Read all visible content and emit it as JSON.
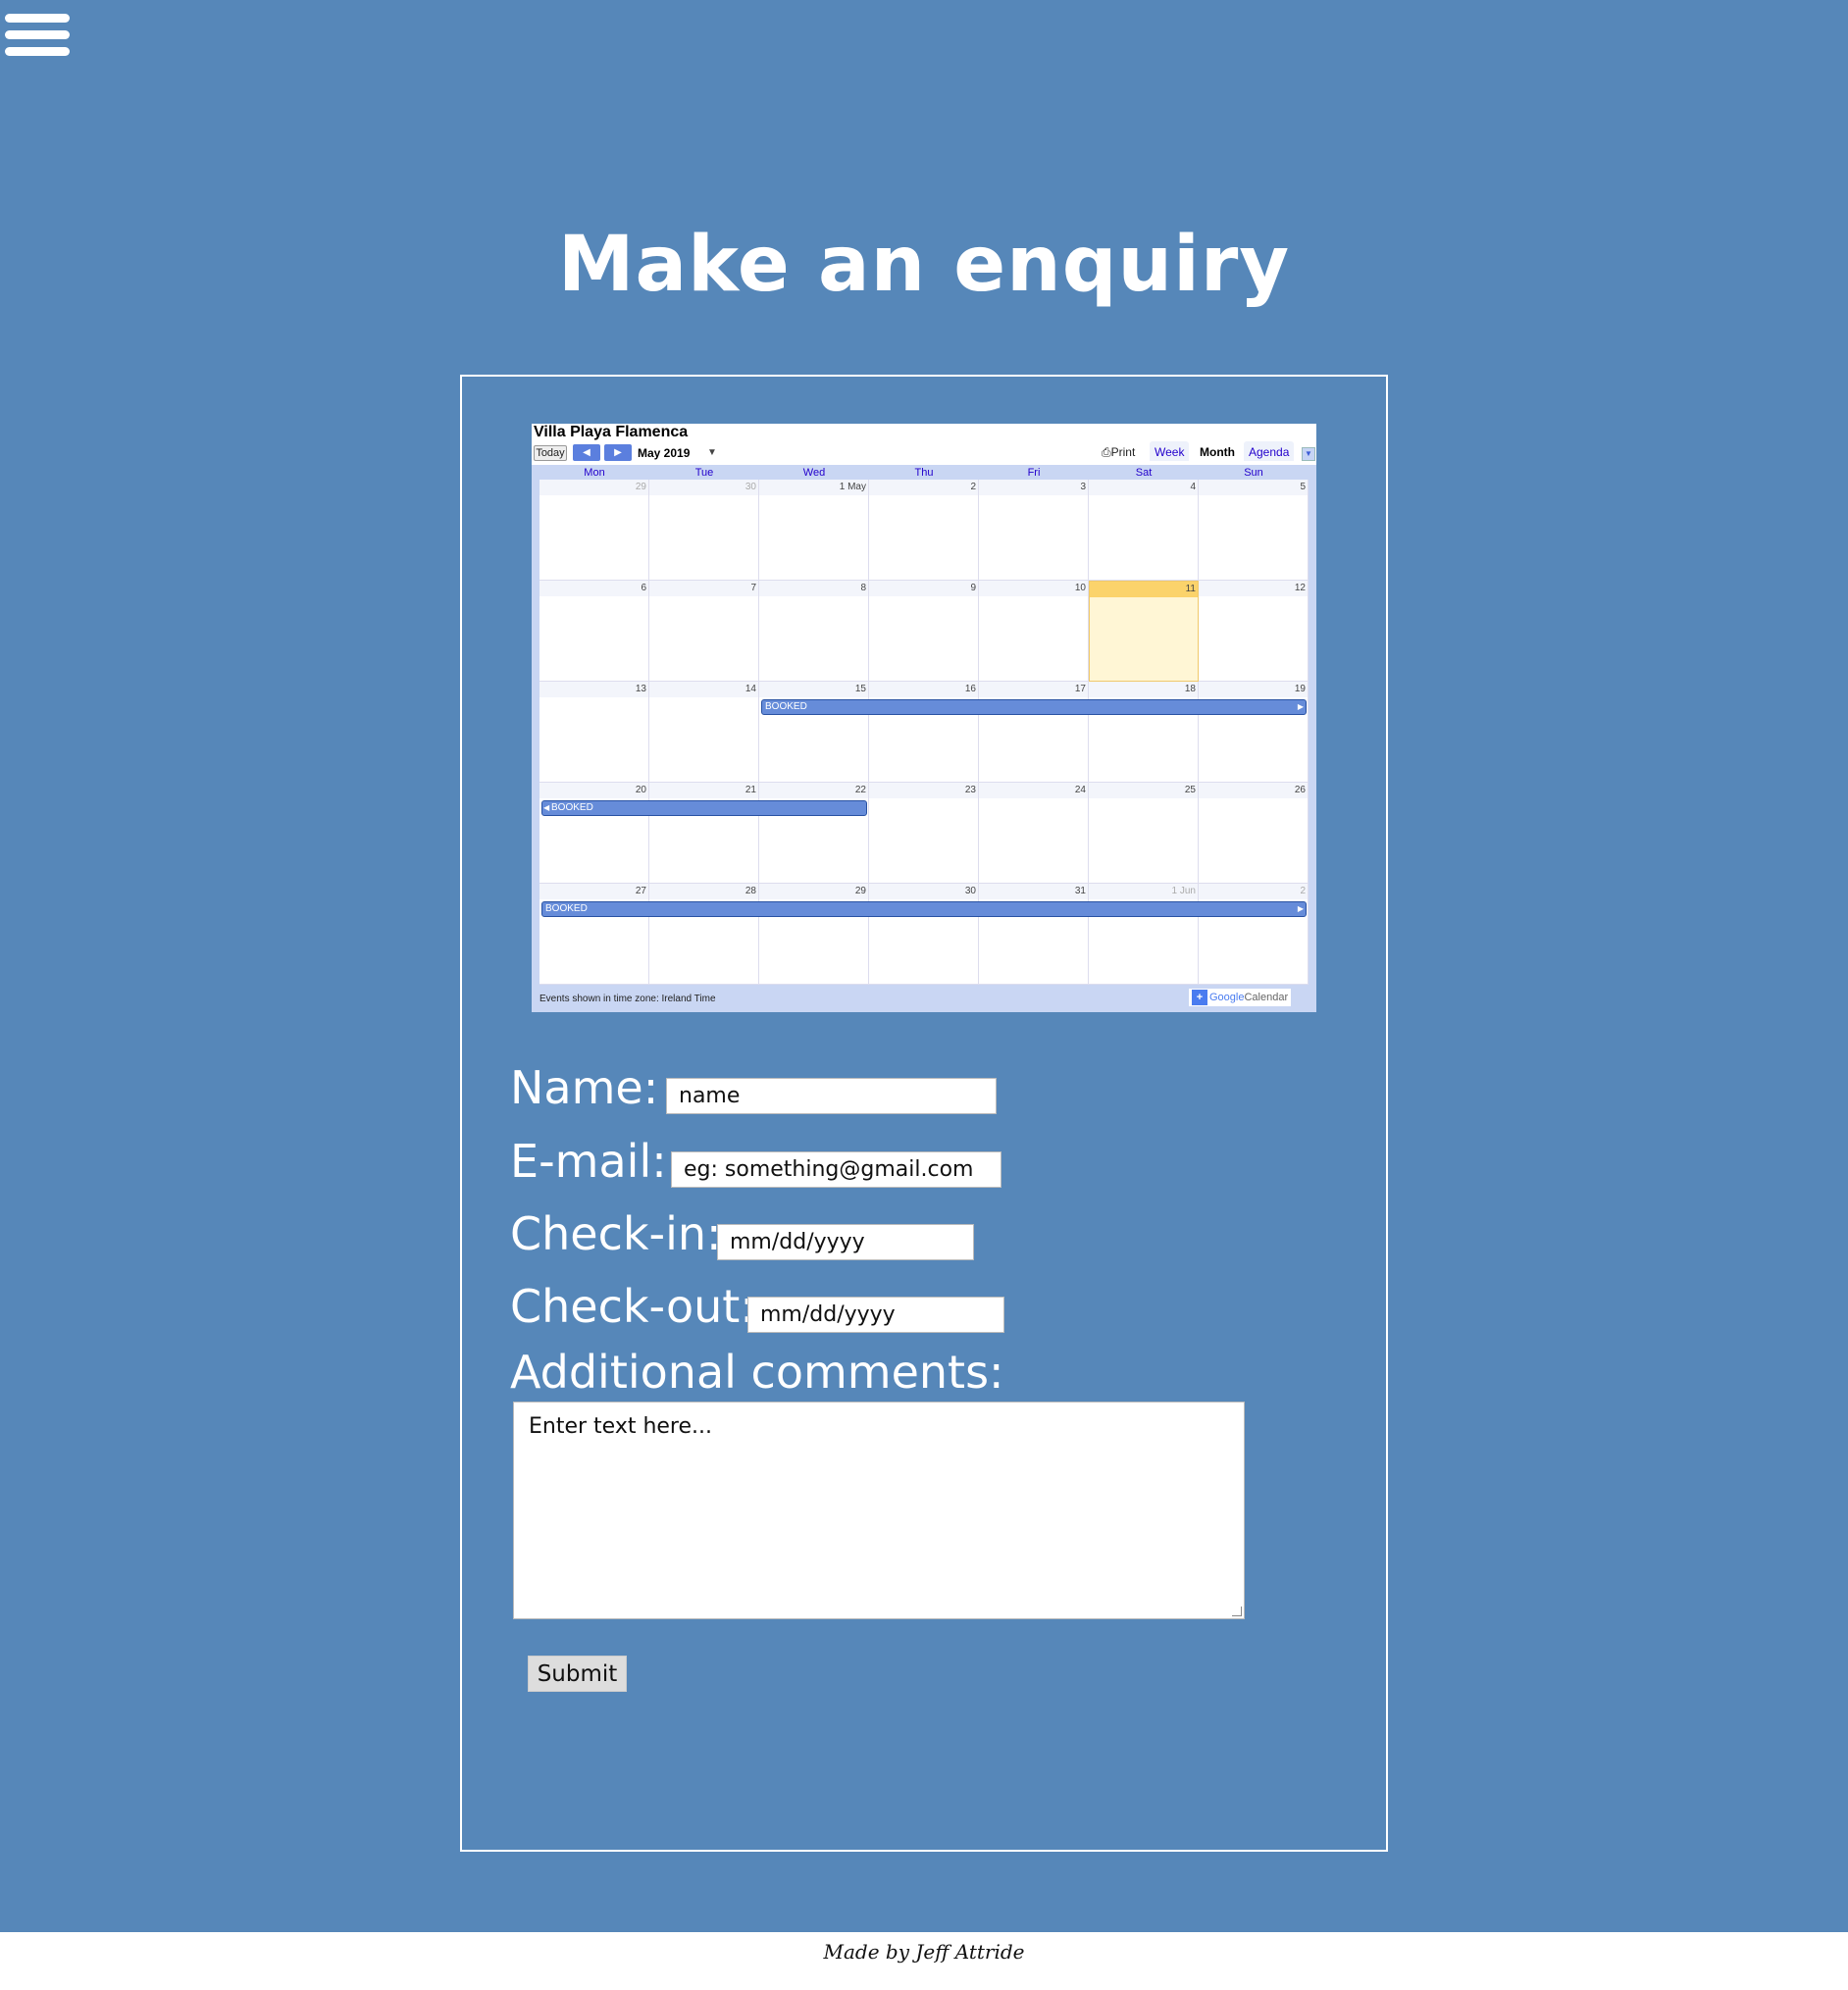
{
  "header": {
    "menu_icon": "hamburger-icon",
    "title": "Make an enquiry"
  },
  "calendar": {
    "title": "Villa Playa Flamenca",
    "today_label": "Today",
    "month_label": "May 2019",
    "print_label": "Print",
    "tabs": [
      "Week",
      "Month",
      "Agenda"
    ],
    "days_of_week": [
      "Mon",
      "Tue",
      "Wed",
      "Thu",
      "Fri",
      "Sat",
      "Sun"
    ],
    "weeks": [
      [
        "29",
        "30",
        "1 May",
        "2",
        "3",
        "4",
        "5"
      ],
      [
        "6",
        "7",
        "8",
        "9",
        "10",
        "11",
        "12"
      ],
      [
        "13",
        "14",
        "15",
        "16",
        "17",
        "18",
        "19"
      ],
      [
        "20",
        "21",
        "22",
        "23",
        "24",
        "25",
        "26"
      ],
      [
        "27",
        "28",
        "29",
        "30",
        "31",
        "1 Jun",
        "2"
      ]
    ],
    "today_date": "11",
    "events": [
      "BOOKED",
      "BOOKED",
      "BOOKED"
    ],
    "footer_text": "Events shown in time zone: Ireland Time",
    "badge_google": "Google",
    "badge_calendar": "Calendar"
  },
  "form": {
    "name_label": "Name:",
    "name_placeholder": "name",
    "email_label": "E-mail:",
    "email_placeholder": "eg: something@gmail.com",
    "checkin_label": "Check-in:",
    "checkin_placeholder": "mm/dd/yyyy",
    "checkout_label": "Check-out:",
    "checkout_placeholder": "mm/dd/yyyy",
    "comments_label": "Additional comments:",
    "comments_placeholder": "Enter text here...",
    "submit_label": "Submit"
  },
  "footer": {
    "text": "Made by Jeff Attride"
  }
}
